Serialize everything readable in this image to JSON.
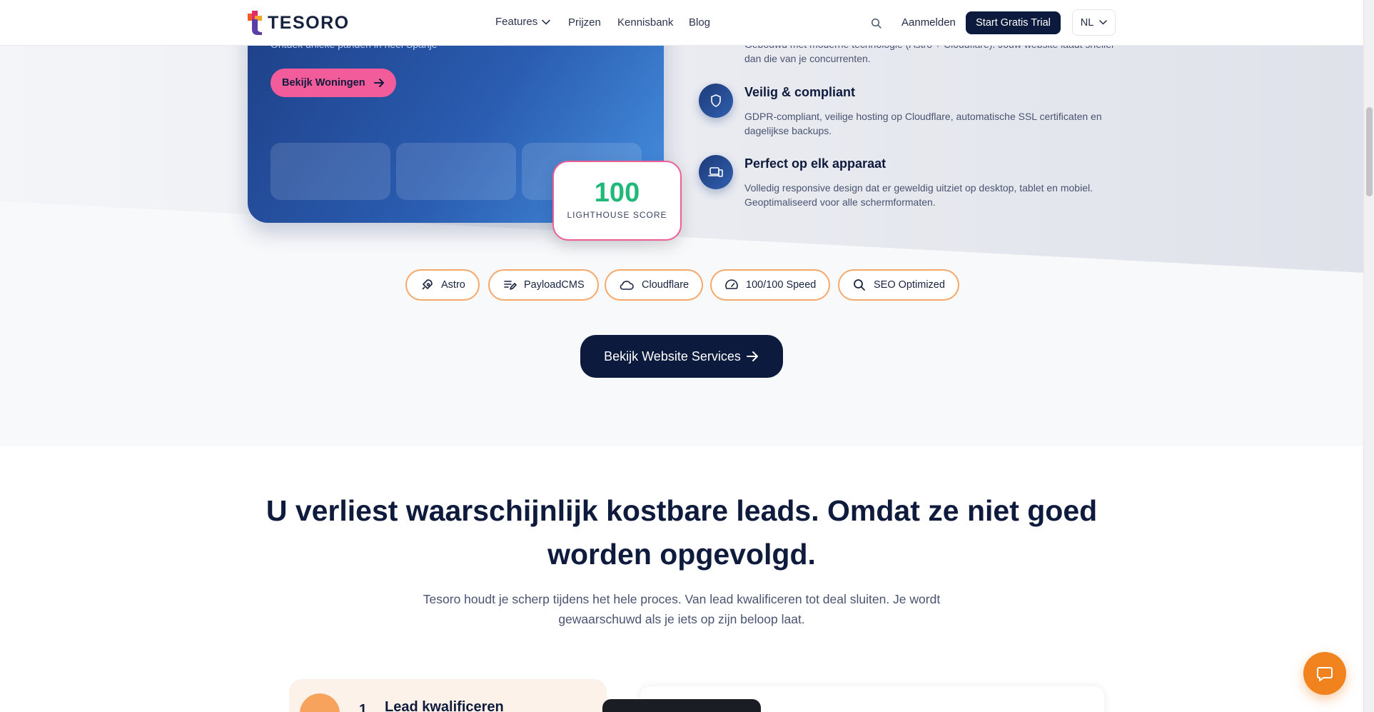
{
  "header": {
    "logo_text": "TESORO",
    "nav": {
      "features": "Features",
      "prijzen": "Prijzen",
      "kennisbank": "Kennisbank",
      "blog": "Blog"
    },
    "login": "Aanmelden",
    "trial": "Start Gratis Trial",
    "language": "NL"
  },
  "hero": {
    "subtitle": "Ontdek unieke panden in heel Spanje",
    "button": "Bekijk Woningen",
    "score_value": "100",
    "score_label": "LIGHTHOUSE SCORE"
  },
  "features": {
    "first_desc": "Gebouwd met moderne technologie (Astro + Cloudflare). Jouw website laadt sneller dan die van je concurrenten.",
    "items": [
      {
        "title": "Veilig & compliant",
        "desc": "GDPR-compliant, veilige hosting op Cloudflare, automatische SSL certificaten en dagelijkse backups.",
        "icon": "shield-icon"
      },
      {
        "title": "Perfect op elk apparaat",
        "desc": "Volledig responsive design dat er geweldig uitziet op desktop, tablet en mobiel. Geoptimaliseerd voor alle schermformaten.",
        "icon": "devices-icon"
      }
    ]
  },
  "tech_pills": [
    {
      "label": "Astro",
      "icon": "rocket-icon"
    },
    {
      "label": "PayloadCMS",
      "icon": "edit-icon"
    },
    {
      "label": "Cloudflare",
      "icon": "cloud-icon"
    },
    {
      "label": "100/100 Speed",
      "icon": "speedometer-icon"
    },
    {
      "label": "SEO Optimized",
      "icon": "search-icon"
    }
  ],
  "services_button": "Bekijk Website Services",
  "leads": {
    "title_line1": "U verliest waarschijnlijk kostbare leads. Omdat ze niet goed",
    "title_line2": "worden opgevolgd.",
    "subtitle": "Tesoro houdt je scherp tijdens het hele proces. Van lead kwalificeren tot deal sluiten. Je wordt gewaarschuwd als je iets op zijn beloop laat.",
    "step_number": "1",
    "step_title": "Lead kwalificeren"
  },
  "colors": {
    "navy": "#0c1a3d",
    "pink": "#f25c9a",
    "green": "#22b87a",
    "orange": "#f0831e",
    "pill_border": "#f5a86b"
  }
}
